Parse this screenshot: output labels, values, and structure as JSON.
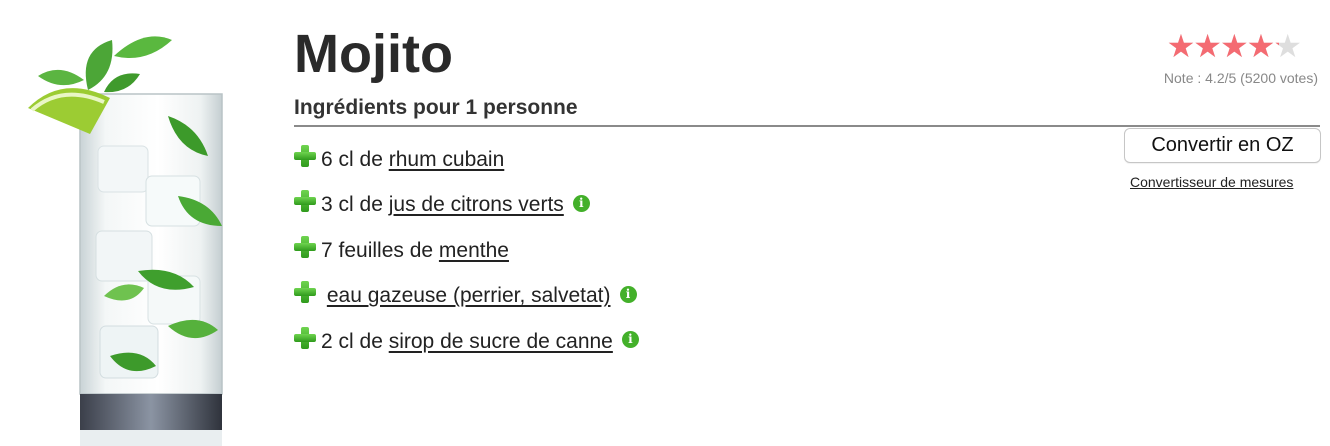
{
  "recipe": {
    "title": "Mojito",
    "ingredients_heading": "Ingrédients pour 1 personne",
    "image_alt": "mojito-glass"
  },
  "ingredients": [
    {
      "quantity": "6 cl de ",
      "name": "rhum cubain",
      "has_info": false
    },
    {
      "quantity": "3 cl de ",
      "name": "jus de citrons verts",
      "has_info": true
    },
    {
      "quantity": "7 feuilles de ",
      "name": "menthe",
      "has_info": false
    },
    {
      "quantity": " ",
      "name": "eau gazeuse (perrier, salvetat)",
      "has_info": true
    },
    {
      "quantity": "2 cl de ",
      "name": "sirop de sucre de canne",
      "has_info": true
    }
  ],
  "rating": {
    "value": 4.2,
    "max": 5,
    "text": "Note : 4.2/5 (5200 votes)"
  },
  "actions": {
    "convert_label": "Convertir en OZ",
    "converter_link": "Convertisseur de mesures"
  },
  "colors": {
    "star_filled": "#f46b72",
    "star_empty": "#dedede",
    "plus_icon": "#3fae2a",
    "info_icon": "#43b02a"
  },
  "icons": {
    "add": "plus-icon",
    "info": "info-icon",
    "star": "star-icon"
  }
}
